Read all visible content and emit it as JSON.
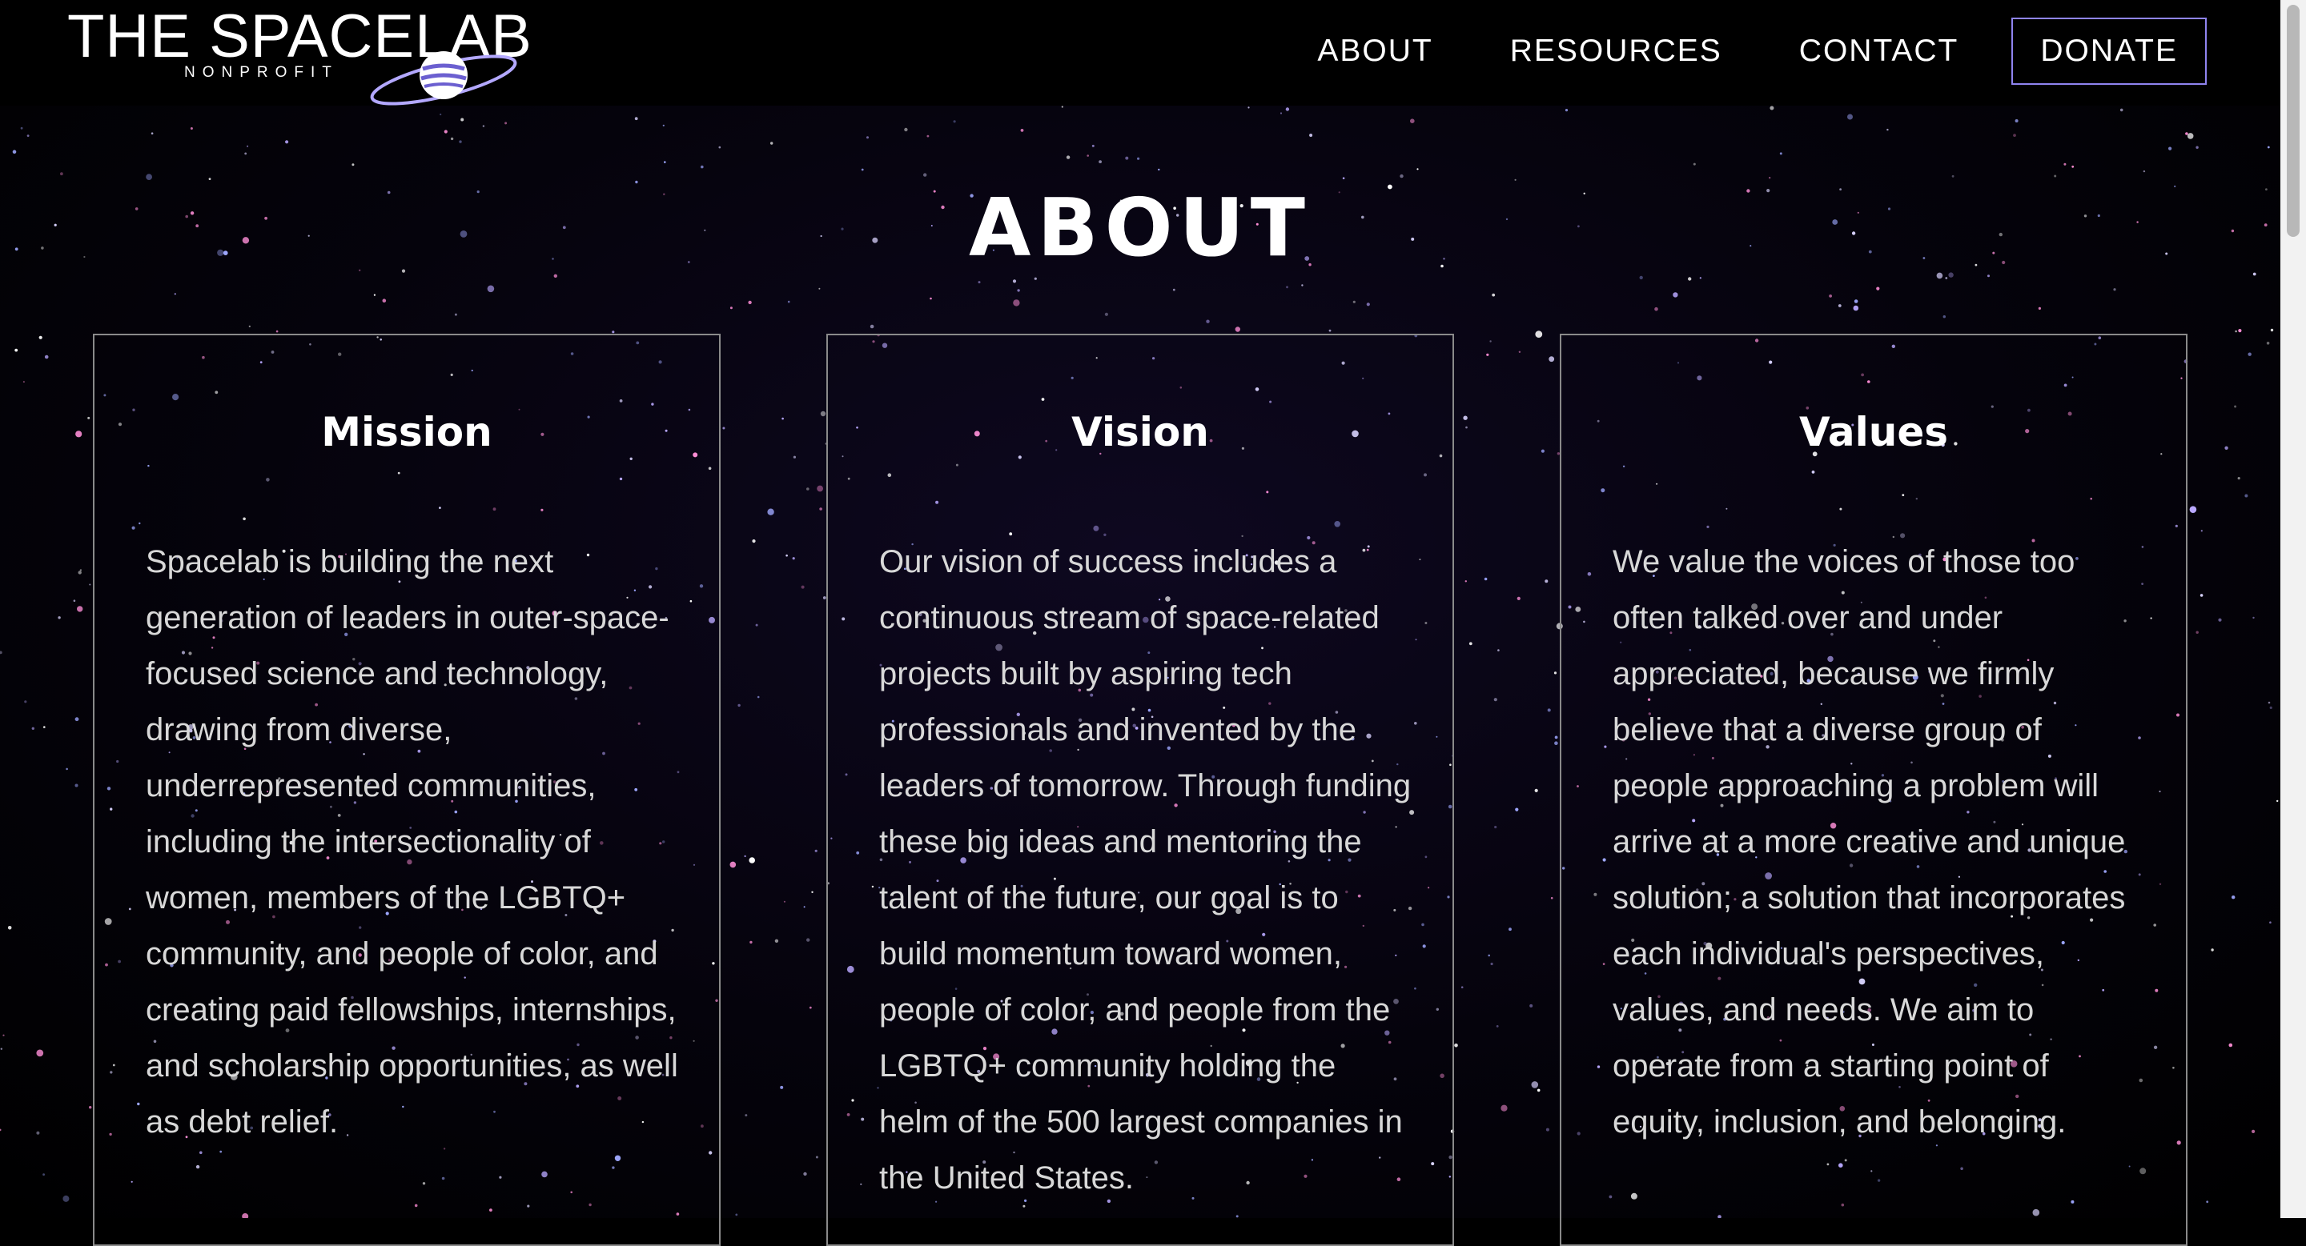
{
  "header": {
    "logo_title": "THE SPACELAB",
    "logo_subtitle": "NONPROFIT",
    "nav": [
      "ABOUT",
      "RESOURCES",
      "CONTACT"
    ],
    "donate_label": "DONATE"
  },
  "main": {
    "title": "ABOUT",
    "cards": [
      {
        "title": "Mission",
        "body": "Spacelab is building the next generation of leaders in outer-space-focused science and technology, drawing from diverse, underrepresented communities, including the intersectionality of women, members of the LGBTQ+ community, and people of color, and creating paid fellowships, internships, and scholarship opportunities, as well as debt relief."
      },
      {
        "title": "Vision",
        "body": "Our vision of success includes a continuous stream of space-related projects built by aspiring tech professionals and invented by the leaders of tomorrow. Through funding these big ideas and mentoring the talent of the future, our goal is to build momentum toward women, people of color, and people from the LGBTQ+ community holding the helm of the 500 largest companies in the United States."
      },
      {
        "title": "Values",
        "body": "We value the voices of those too often talked over and under appreciated, because we firmly believe that a diverse group of people approaching a problem will arrive at a more creative and unique solution; a solution that incorporates each individual's perspectives, values, and needs. We aim to operate from a starting point of equity, inclusion, and belonging."
      }
    ]
  },
  "colors": {
    "background": "#000000",
    "accent": "#8f84f0",
    "card_border": "#8a8a8a",
    "body_text": "#d8d8d8"
  }
}
